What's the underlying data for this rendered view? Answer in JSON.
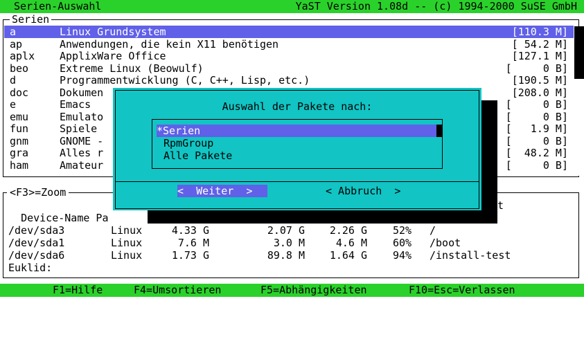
{
  "topbar": {
    "left": "Serien-Auswahl",
    "right": "YaST Version 1.08d -- (c) 1994-2000 SuSE GmbH"
  },
  "series": {
    "title": "Serien",
    "items": [
      {
        "code": "a",
        "desc": "Linux Grundsystem",
        "size": "[110.3 M]"
      },
      {
        "code": "ap",
        "desc": "Anwendungen, die kein X11 benötigen",
        "size": "[ 54.2 M]"
      },
      {
        "code": "aplx",
        "desc": "ApplixWare Office",
        "size": "[127.1 M]"
      },
      {
        "code": "beo",
        "desc": "Extreme Linux (Beowulf)",
        "size": "[     0 B]"
      },
      {
        "code": "d",
        "desc": "Programmentwicklung (C, C++, Lisp, etc.)",
        "size": "[190.5 M]"
      },
      {
        "code": "doc",
        "desc": "Dokumen",
        "size": "[208.0 M]"
      },
      {
        "code": "e",
        "desc": "Emacs",
        "size": "[     0 B]"
      },
      {
        "code": "emu",
        "desc": "Emulato",
        "size": "[     0 B]"
      },
      {
        "code": "fun",
        "desc": "Spiele",
        "size": "[   1.9 M]"
      },
      {
        "code": "gnm",
        "desc": "GNOME -",
        "size": "[     0 B]"
      },
      {
        "code": "gra",
        "desc": "Alles r",
        "size": "[  48.2 M]"
      },
      {
        "code": "ham",
        "desc": "Amateur",
        "size": "[     0 B]"
      }
    ]
  },
  "device": {
    "zoom_label": "<F3>=Zoom",
    "header_left": "Device-Name Pa",
    "header_right": "t",
    "rows": [
      {
        "dev": "/dev/sda3",
        "fs": "Linux",
        "size": "4.33 G",
        "used": "2.07 G",
        "free": "2.26 G",
        "pct": "52%",
        "mount": "/"
      },
      {
        "dev": "/dev/sda1",
        "fs": "Linux",
        "size": "7.6 M",
        "used": "3.0 M",
        "free": "4.6 M",
        "pct": "60%",
        "mount": "/boot"
      },
      {
        "dev": "/dev/sda6",
        "fs": "Linux",
        "size": "1.73 G",
        "used": "89.8 M",
        "free": "1.64 G",
        "pct": "94%",
        "mount": "/install-test"
      }
    ],
    "footer": "Euklid:"
  },
  "dialog": {
    "title": "Auswahl der Pakete nach:",
    "options": [
      "*Serien",
      "RpmGroup",
      "Alle Pakete"
    ],
    "weiter": "<  Weiter  >",
    "abbruch": "< Abbruch  >"
  },
  "bottombar": {
    "help": "F1=Hilfe",
    "sort": "F4=Umsortieren",
    "deps": "F5=Abhängigkeiten",
    "quit": "F10=Esc=Verlassen"
  },
  "colors": {
    "green": "#2bd12b",
    "selection": "#6060e8",
    "dialog": "#12c4c4"
  }
}
